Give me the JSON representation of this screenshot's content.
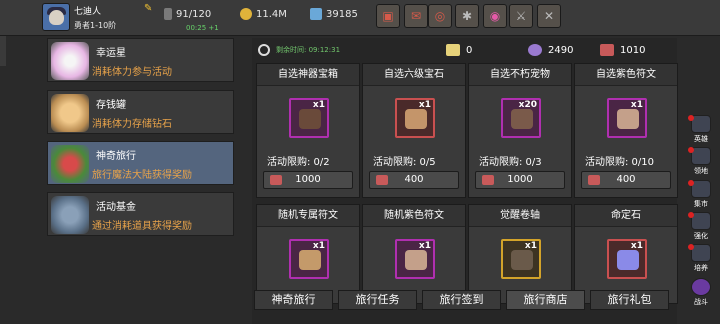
{
  "player": {
    "name": "七迪人",
    "title": "勇者1-10阶"
  },
  "resources": {
    "stamina": "91/120",
    "stamina_timer": "00:25 +1",
    "gold": "11.4M",
    "gems": "39185"
  },
  "toolbar": {
    "icons": [
      "chest-icon",
      "mail-icon",
      "gamepad-icon",
      "settings-icon",
      "color-wheel-icon",
      "sword-icon",
      "crossed-swords-icon"
    ]
  },
  "menu": [
    {
      "title": "幸运星",
      "desc": "消耗体力参与活动",
      "icon": "star-icon"
    },
    {
      "title": "存钱罐",
      "desc": "消耗体力存储钻石",
      "icon": "piggy-bank-icon"
    },
    {
      "title": "神奇旅行",
      "desc": "旅行魔法大陆获得奖励",
      "icon": "travel-gift-icon"
    },
    {
      "title": "活动基金",
      "desc": "通过消耗道具获得奖励",
      "icon": "fund-bag-icon"
    }
  ],
  "shop": {
    "remaining_time": "剩余时间: 09:12:31",
    "currencies": [
      {
        "icon": "ticket-icon",
        "value": "0"
      },
      {
        "icon": "flower-icon",
        "value": "2490"
      },
      {
        "icon": "boot-icon",
        "value": "1010"
      }
    ],
    "cards": [
      {
        "name": "自选神器宝箱",
        "qty": "x1",
        "limit": "活动限购: 0/2",
        "price": "1000",
        "frame": "epic"
      },
      {
        "name": "自选六级宝石",
        "qty": "x1",
        "limit": "活动限购: 0/5",
        "price": "400",
        "frame": "rare"
      },
      {
        "name": "自选不朽宠物",
        "qty": "x20",
        "limit": "活动限购: 0/3",
        "price": "1000",
        "frame": "epic"
      },
      {
        "name": "自选紫色符文",
        "qty": "x1",
        "limit": "活动限购: 0/10",
        "price": "400",
        "frame": "epic"
      },
      {
        "name": "随机专属符文",
        "qty": "x1",
        "limit": "",
        "price": "",
        "frame": "epic"
      },
      {
        "name": "随机紫色符文",
        "qty": "x1",
        "limit": "",
        "price": "",
        "frame": "epic"
      },
      {
        "name": "觉醒卷轴",
        "qty": "x1",
        "limit": "",
        "price": "",
        "frame": "gold"
      },
      {
        "name": "命定石",
        "qty": "x1",
        "limit": "",
        "price": "",
        "frame": "rare"
      }
    ]
  },
  "tabs": [
    "神奇旅行",
    "旅行任务",
    "旅行签到",
    "旅行商店",
    "旅行礼包"
  ],
  "sidebar": [
    {
      "label": "英雄",
      "icon": "hero-icon"
    },
    {
      "label": "领地",
      "icon": "territory-icon"
    },
    {
      "label": "集市",
      "icon": "market-icon"
    },
    {
      "label": "强化",
      "icon": "upgrade-icon"
    },
    {
      "label": "培养",
      "icon": "train-icon"
    },
    {
      "label": "战斗",
      "icon": "battle-icon"
    }
  ],
  "colors": {
    "accent_orange": "#e8a34a",
    "timer_green": "#67d36a",
    "epic_purple": "#b02fb0",
    "rare_red": "#c95050",
    "gold": "#d4a42a"
  }
}
